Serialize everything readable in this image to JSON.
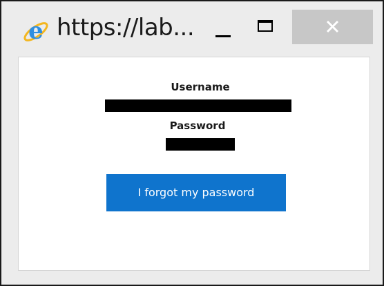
{
  "window": {
    "title": "https://lab...",
    "icon": "internet-explorer-icon",
    "controls": {
      "minimize_icon": "minimize-icon",
      "maximize_icon": "maximize-icon",
      "close_icon": "close-icon",
      "close_bg": "#c7c7c7"
    }
  },
  "form": {
    "username_label": "Username",
    "username_value": "",
    "password_label": "Password",
    "password_value": "",
    "forgot_button_label": "I forgot my password",
    "button_color": "#0f74cd"
  }
}
